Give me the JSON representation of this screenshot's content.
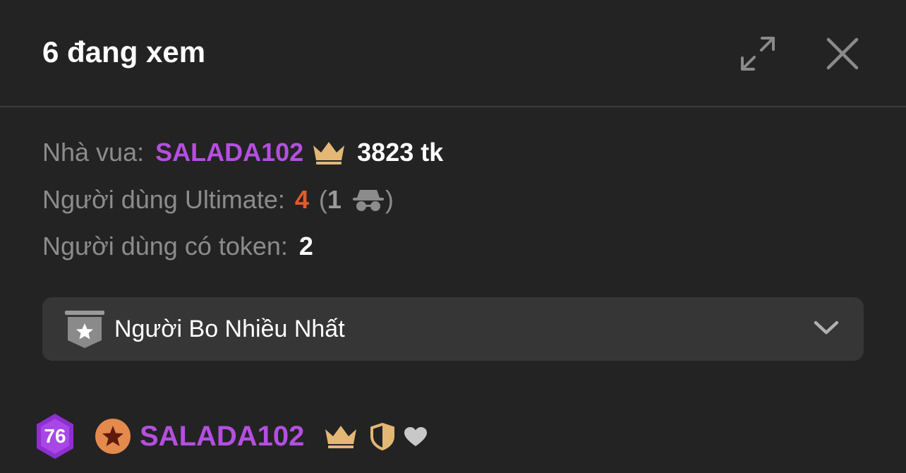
{
  "header": {
    "title": "6 đang xem",
    "expand_icon": "expand-icon",
    "close_icon": "close-icon"
  },
  "stats": {
    "king_label": "Nhà vua:",
    "king_name": "SALADA102",
    "king_tokens": "3823 tk",
    "ultimate_label": "Người dùng Ultimate:",
    "ultimate_count": "4",
    "ultimate_open_paren": "(",
    "ultimate_anonymous_count": "1",
    "ultimate_close_paren": ")",
    "token_users_label": "Người dùng có token:",
    "token_users_count": "2"
  },
  "dropdown": {
    "label": "Người Bo Nhiều Nhất",
    "icon": "star-badge-icon",
    "chevron": "chevron-down-icon"
  },
  "user_list": [
    {
      "level": "76",
      "name": "SALADA102"
    }
  ],
  "colors": {
    "background": "#232323",
    "king_purple": "#b44fe0",
    "ultimate_orange": "#e45a2a",
    "crown_gold": "#e3b774",
    "level_badge_purple": "#8e2fd0",
    "rank_badge_orange": "#e38a4c"
  }
}
